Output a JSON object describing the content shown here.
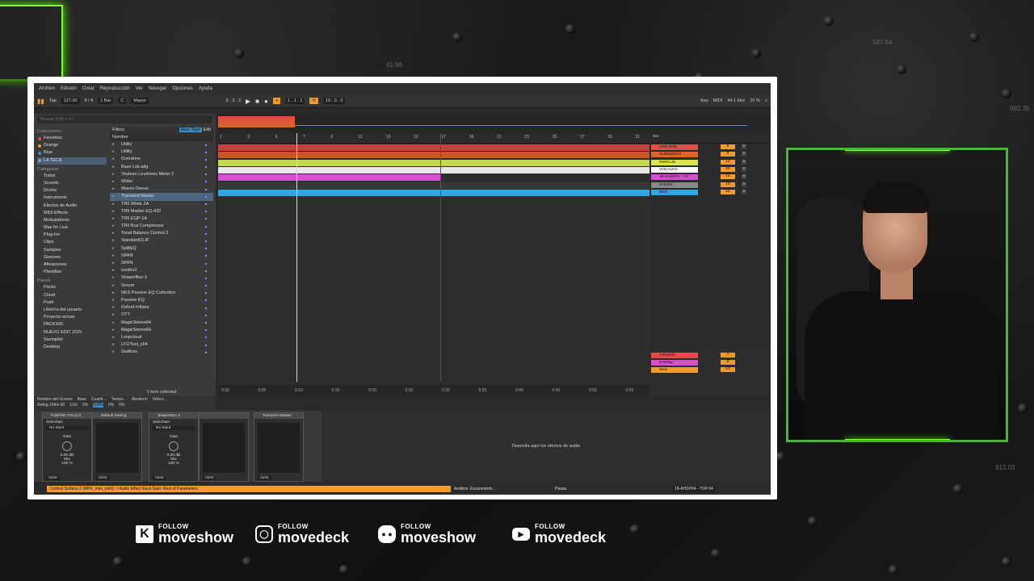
{
  "menu": [
    "Archivo",
    "Edición",
    "Crear",
    "Reproducción",
    "Ver",
    "Navegar",
    "Opciones",
    "Ayuda"
  ],
  "transport": {
    "tap": "Tap",
    "tempo": "127.00",
    "time_sig": "4 / 4",
    "quant": "1 Bar",
    "key": "C",
    "scale": "Mayor",
    "position": "6 . 3 . 3",
    "loop_start": "1 . 1 . 1",
    "loop_len": "16 . 0 . 0",
    "key_btn": "Key",
    "midi_btn": "MIDI",
    "sample_rate": "44.1 kHz",
    "cpu": "10 %"
  },
  "browser": {
    "search_placeholder": "Buscar (Ctrl + F)",
    "filters": "Filtros",
    "auto_tags": "Auto Tags",
    "edit": "Edit",
    "name_header": "Nombre",
    "collections_title": "Colecciones",
    "collections": [
      {
        "label": "Favoritos",
        "color": "#e84a4a"
      },
      {
        "label": "Orange",
        "color": "#f39a2b"
      },
      {
        "label": "Blue",
        "color": "#3c8fc8"
      },
      {
        "label": "LA TECA",
        "color": "#6fa8dc"
      }
    ],
    "categories_title": "Categorías",
    "categories": [
      "Todos",
      "Sounds",
      "Drums",
      "Instruments",
      "Efectos de Audio",
      "MIDI Effects",
      "Moduladores",
      "Max for Live",
      "Plug-Ins",
      "Clips",
      "Samples",
      "Grooves",
      "Afinaciones",
      "Plantillas"
    ],
    "places_title": "Places",
    "places": [
      "Packs",
      "Cloud",
      "Push",
      "Librería del usuario",
      "Proyecto actual",
      "PACKS65",
      "NUEVO EDIT 2025",
      "Sacmplist",
      "Desktop"
    ],
    "items": [
      "Utility",
      "Utility",
      "Overdrive",
      "Bass Lok.adg",
      "Youlean Loudness Meter 2",
      "Wider",
      "Waves Deess",
      "Transient Master",
      "TR5 White 2A",
      "TR5 Master EQ-432",
      "TR5 EQP-1A",
      "TR5 Bus Compressor",
      "Tonal Balance Control 2",
      "StandardCLIP",
      "SplitEQ",
      "SPAN",
      "SPAN",
      "soothe2",
      "ShaperBox 3",
      "Serum",
      "NKS Passive EQ Collection",
      "Passive EQ",
      "Oxford Inflator",
      "OTT",
      "MagicStereo64",
      "MagicStereo64",
      "Loopcloud",
      "LFOTool_x64",
      "Guilfoss"
    ],
    "footer": "1 item selected"
  },
  "groove": {
    "label": "Nombre del Groove",
    "value": "Swing 16ths 66",
    "base": "Base",
    "quant": "Cuanti...",
    "timing": "Tempo...",
    "random": "Aleatorio",
    "vel": "Veloci...",
    "base_v": "1/16",
    "q_v": "0%",
    "t_v": "100%",
    "r_v": "0%",
    "v_v": "0%",
    "global": "Cantidad Global",
    "global_v": "0%",
    "pool": "Groove Pool"
  },
  "ruler": [
    "1",
    "3",
    "5",
    "7",
    "9",
    "11",
    "13",
    "15",
    "17",
    "19",
    "21",
    "23",
    "25",
    "27",
    "29",
    "31"
  ],
  "clip_text": "La Isla Bonita-drums] [2026-0 La Isla Bonita-drums] [2026-0 La Isla Bonita-drums]",
  "pink_clip": "AHSP04 - TOP 04",
  "tracks": [
    {
      "name": "LINK END",
      "color": "#e84a4a",
      "vol": "0"
    },
    {
      "name": "SUBSERIAS",
      "color": "#e0622a",
      "vol": "0"
    },
    {
      "name": "PERCUS",
      "color": "#d9e84a",
      "vol": "14"
    },
    {
      "name": "VOCALES",
      "color": "#ffffff",
      "vol": "15"
    },
    {
      "name": "18-AHSP04 - TO",
      "color": "#d64fd0",
      "vol": "16"
    },
    {
      "name": "STEMS",
      "color": "#888888",
      "vol": "18"
    },
    {
      "name": "MIDI",
      "color": "#2aaae0",
      "vol": "22"
    }
  ],
  "returns": [
    {
      "name": "A Reverb",
      "color": "#e84a4a",
      "vol": "A"
    },
    {
      "name": "B Delay",
      "color": "#d64fd0",
      "vol": "B"
    },
    {
      "name": "Main",
      "color": "#f39a2b",
      "vol": "1/2"
    }
  ],
  "set_label": "Set",
  "timeline": [
    "0:00",
    "0:05",
    "0:10",
    "0:15",
    "0:20",
    "0:25",
    "0:30",
    "0:35",
    "0:40",
    "0:45",
    "0:50",
    "0:55"
  ],
  "devices": [
    {
      "title": "FabFilter Pro-Q 3",
      "side": "Sidechain",
      "input": "No Input",
      "gain": "Gain",
      "db": "0.00 dB",
      "mix": "Mix",
      "pct": "100 %",
      "none": "none"
    },
    {
      "title": "Default Setting",
      "side": "",
      "input": "",
      "gain": "",
      "db": "",
      "mix": "",
      "pct": "",
      "none": "none"
    },
    {
      "title": "ShaperBox 3",
      "side": "Sidechain",
      "input": "No Input",
      "gain": "Gain",
      "db": "0.00 dB",
      "mix": "Mix",
      "pct": "100 %",
      "none": "none"
    },
    {
      "title": "Transient Master",
      "side": "",
      "input": "",
      "gain": "",
      "db": "",
      "mix": "",
      "pct": "",
      "none": "none"
    }
  ],
  "dropzone": "Deposita aquí los efectos de audio",
  "status": {
    "left": "Control Surface 2 (MPK_mini_mkII): > Audio Effect Rack Gain: Rest of Parameters",
    "analysis": "Análisis: Escaneando ...",
    "pause": "Pausa",
    "track": "18-AHSP04 - TOP 04"
  },
  "socials": [
    {
      "icon": "kick-icon",
      "follow": "FOLLOW",
      "handle": "moveshow"
    },
    {
      "icon": "instagram-icon",
      "follow": "FOLLOW",
      "handle": "movedeck"
    },
    {
      "icon": "discord-icon",
      "follow": "FOLLOW",
      "handle": "moveshow"
    },
    {
      "icon": "youtube-icon",
      "follow": "FOLLOW",
      "handle": "movedeck"
    }
  ],
  "ghost_numbers": [
    "41.96",
    "587.64",
    "992.36",
    "913.03"
  ]
}
